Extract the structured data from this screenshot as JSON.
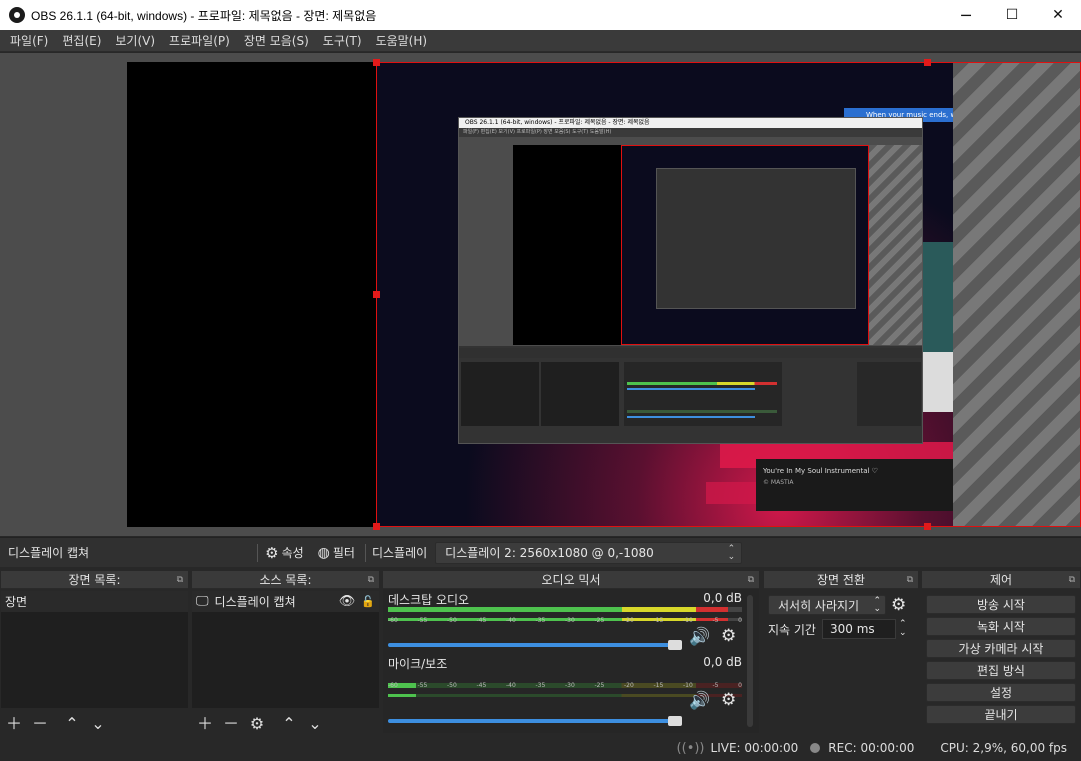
{
  "window": {
    "title": "OBS 26.1.1 (64-bit, windows) - 프로파일: 제목없음 - 장면: 제목없음",
    "minimize": "─",
    "maximize": "☐",
    "close": "✕"
  },
  "menu": [
    "파일(F)",
    "편집(E)",
    "보기(V)",
    "프로파일(P)",
    "장면 모음(S)",
    "도구(T)",
    "도움말(H)"
  ],
  "preview_inner": {
    "title": "OBS 26.1.1 (64-bit, windows) - 프로파일: 제목없음 - 장면: 제목없음",
    "notification": "When your music ends, we co",
    "song_title": "You're In My Soul Instrumental ♡",
    "song_artist": "© MASTIA"
  },
  "source_toolbar": {
    "source_name": "디스플레이 캡쳐",
    "properties_label": "속성",
    "filters_label": "필터",
    "display_label": "디스플레이",
    "display_value": "디스플레이 2: 2560x1080 @ 0,-1080"
  },
  "scenes": {
    "header": "장면 목록:",
    "items": [
      "장면"
    ]
  },
  "sources": {
    "header": "소스 목록:",
    "items": [
      "디스플레이 캡쳐"
    ]
  },
  "mixer": {
    "header": "오디오 믹서",
    "tick_labels": [
      "-60",
      "-55",
      "-50",
      "-45",
      "-40",
      "-35",
      "-30",
      "-25",
      "-20",
      "-15",
      "-10",
      "-5",
      "0"
    ],
    "channels": [
      {
        "name": "데스크탑 오디오",
        "db": "0,0 dB",
        "level": 0.96
      },
      {
        "name": "마이크/보조",
        "db": "0,0 dB",
        "level": 0.08
      }
    ]
  },
  "transitions": {
    "header": "장면 전환",
    "type": "서서히 사라지기",
    "duration_label": "지속 기간",
    "duration_value": "300 ms"
  },
  "controls": {
    "header": "제어",
    "buttons": [
      "방송 시작",
      "녹화 시작",
      "가상 카메라 시작",
      "편집 방식",
      "설정",
      "끝내기"
    ]
  },
  "status": {
    "live": "LIVE: 00:00:00",
    "rec": "REC: 00:00:00",
    "cpu": "CPU: 2,9%, 60,00 fps"
  },
  "colors": {
    "selection": "#e01010",
    "meter_green": "#4ec24e",
    "meter_yellow": "#d8d82a",
    "meter_red": "#d23030",
    "slider": "#3d8fe0"
  }
}
